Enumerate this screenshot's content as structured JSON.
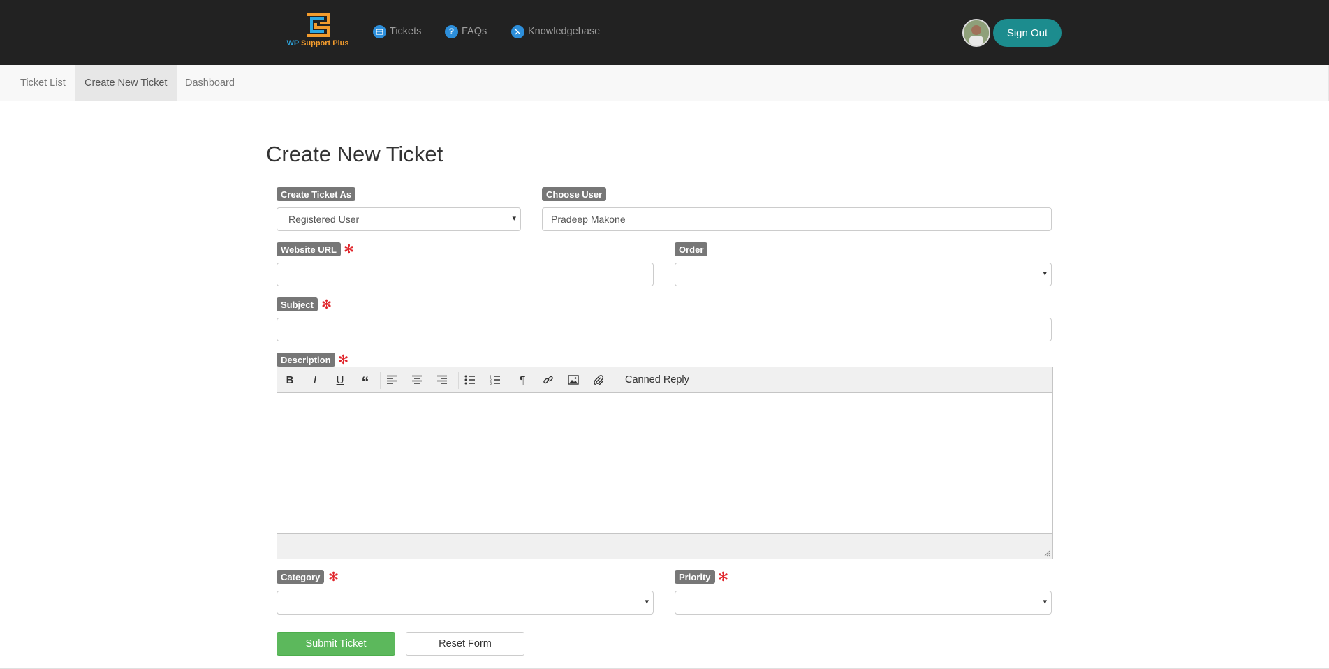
{
  "brand": {
    "logo_text_wp": "WP",
    "logo_text_rest": "Support Plus",
    "logo_colors": {
      "blue": "#2ea7e0",
      "orange": "#f39c2d"
    }
  },
  "topnav": {
    "items": [
      {
        "label": "Tickets",
        "icon": "ticket-icon"
      },
      {
        "label": "FAQs",
        "icon": "question-icon"
      },
      {
        "label": "Knowledgebase",
        "icon": "knowledgebase-icon"
      }
    ],
    "sign_out_label": "Sign Out",
    "sign_out_color": "#1c8c8e"
  },
  "subnav": {
    "items": [
      {
        "label": "Ticket List",
        "active": false
      },
      {
        "label": "Create New Ticket",
        "active": true
      },
      {
        "label": "Dashboard",
        "active": false
      }
    ]
  },
  "page": {
    "title": "Create New Ticket"
  },
  "form": {
    "create_as": {
      "label": "Create Ticket As",
      "value": "Registered User"
    },
    "choose_user": {
      "label": "Choose User",
      "value": "Pradeep Makone"
    },
    "website_url": {
      "label": "Website URL",
      "value": "",
      "required": true
    },
    "order": {
      "label": "Order",
      "value": ""
    },
    "subject": {
      "label": "Subject",
      "value": "",
      "required": true
    },
    "description": {
      "label": "Description",
      "required": true,
      "canned_reply_label": "Canned Reply"
    },
    "category": {
      "label": "Category",
      "value": "",
      "required": true
    },
    "priority": {
      "label": "Priority",
      "value": "",
      "required": true
    },
    "required_mark": "✻",
    "submit_label": "Submit Ticket",
    "reset_label": "Reset Form"
  }
}
